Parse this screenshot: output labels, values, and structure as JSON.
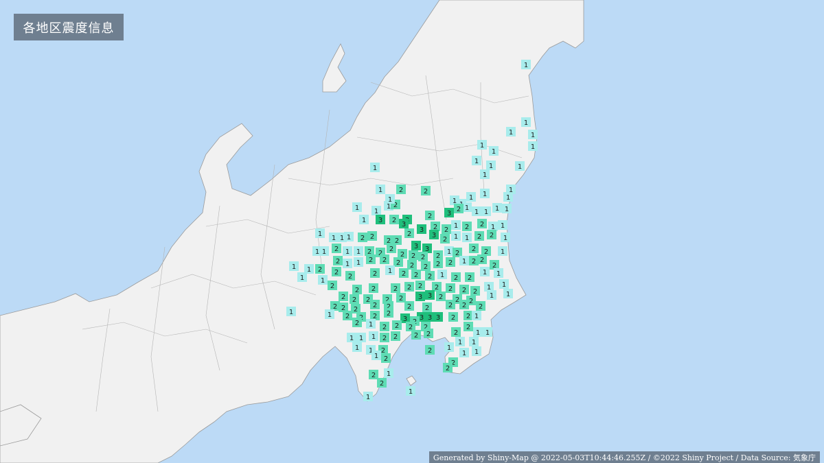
{
  "title": "各地区震度信息",
  "footer": "Generated by Shiny-Map @ 2022-05-03T10:44:46.255Z / ©2022 Shiny Project / Data Source: 気象庁",
  "colors": {
    "sea": "#bcdaf6",
    "land": "#f1f1f1",
    "intensity_1": "#a8ecec",
    "intensity_2": "#5edcb4",
    "intensity_3": "#1fbf7c"
  }
}
